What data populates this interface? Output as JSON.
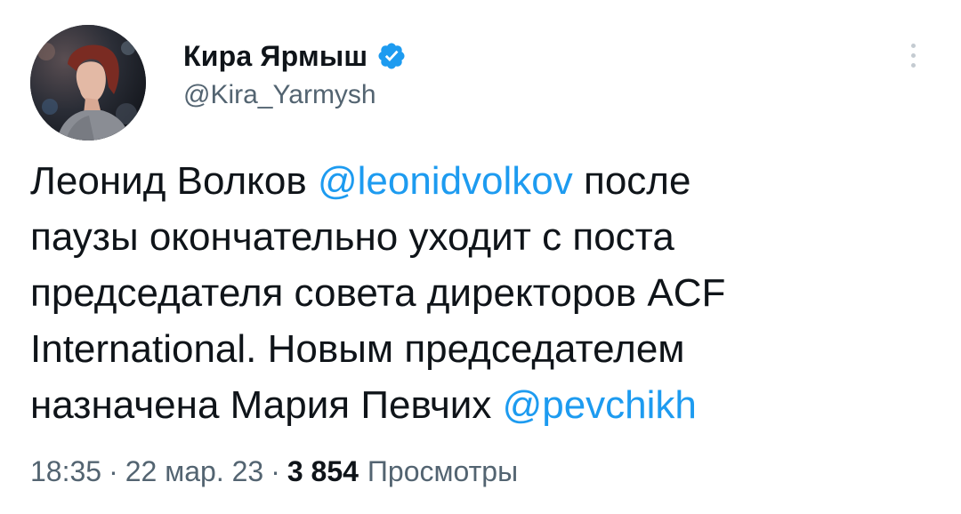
{
  "author": {
    "display_name": "Кира Ярмыш",
    "handle": "@Kira_Yarmysh",
    "verified": true,
    "avatar_icon": "profile-photo",
    "verified_icon": "verified-badge-icon",
    "verified_color": "#1d9bf0"
  },
  "menu": {
    "icon": "more-options-icon"
  },
  "tweet": {
    "lines": [
      [
        {
          "text": "Леонид Волков ",
          "type": "text"
        },
        {
          "text": "@leonidvolkov",
          "type": "mention"
        },
        {
          "text": " после",
          "type": "text"
        }
      ],
      [
        {
          "text": "паузы окончательно уходит с поста",
          "type": "text"
        }
      ],
      [
        {
          "text": "председателя совета директоров ACF",
          "type": "text"
        }
      ],
      [
        {
          "text": "International. Новым председателем",
          "type": "text"
        }
      ],
      [
        {
          "text": "назначена Мария Певчих ",
          "type": "text"
        },
        {
          "text": "@pevchikh",
          "type": "mention"
        }
      ]
    ]
  },
  "meta": {
    "time": "18:35",
    "separator": "·",
    "date": "22 мар. 23",
    "views_count": "3 854",
    "views_label": "Просмотры"
  },
  "colors": {
    "text": "#0f1419",
    "secondary": "#536471",
    "link": "#1d9bf0",
    "background": "#ffffff"
  }
}
